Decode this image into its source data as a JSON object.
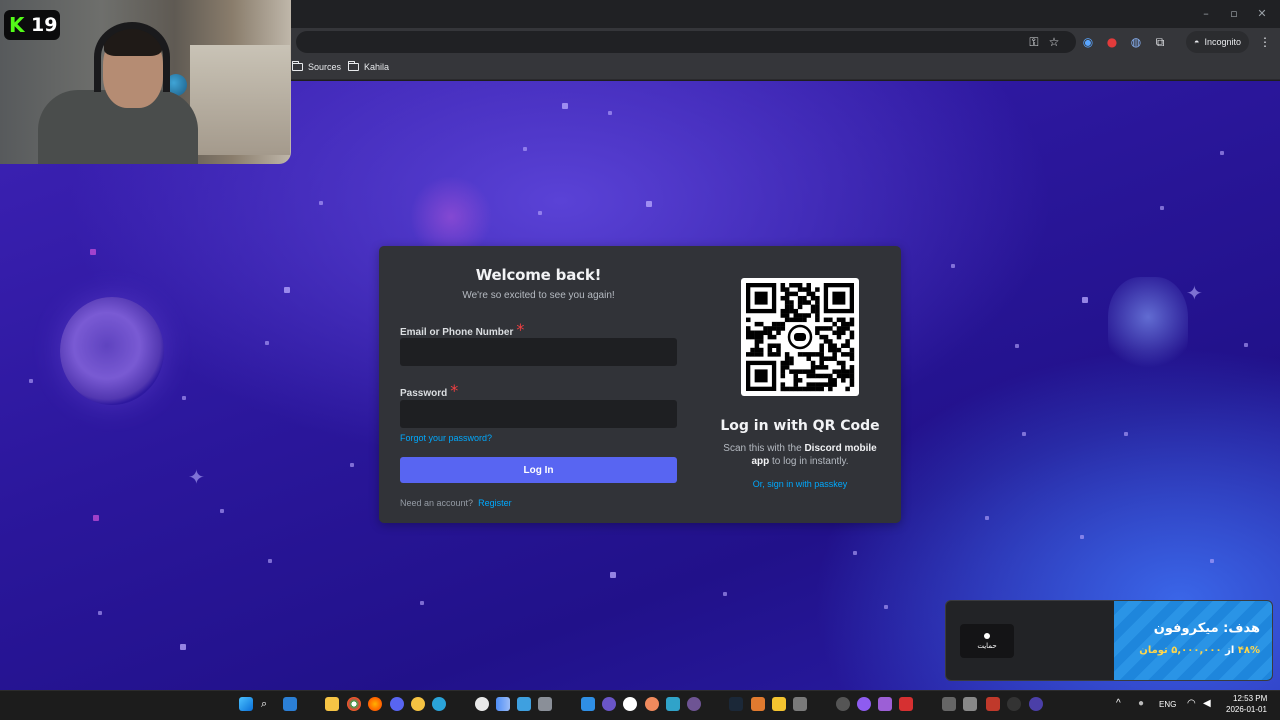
{
  "browser": {
    "bookmarks": [
      "Sources",
      "Kahila"
    ],
    "incognito_label": "Incognito",
    "colors": {
      "frame": "#202124",
      "toolbar": "#35363a"
    }
  },
  "login": {
    "title": "Welcome back!",
    "subtitle": "We're so excited to see you again!",
    "email_label": "Email or Phone Number",
    "email_value": "",
    "password_label": "Password",
    "password_value": "",
    "required_mark": "*",
    "forgot_link": "Forgot your password?",
    "login_button": "Log In",
    "need_account": "Need an account?",
    "register_link": "Register",
    "colors": {
      "card": "#313338",
      "input": "#1e1f22",
      "button": "#5865f2",
      "link": "#00a8fc",
      "required": "#f23f42"
    }
  },
  "qr": {
    "title": "Log in with QR Code",
    "desc_prefix": "Scan this with the",
    "desc_bold": "Discord mobile app",
    "desc_suffix": "to log in instantly.",
    "passkey_link": "Or, sign in with passkey"
  },
  "stream": {
    "viewer_count": "19"
  },
  "donation": {
    "goal_title": "هدف: میکروفون",
    "goal_percent": "۴۸%",
    "goal_connector": "از",
    "goal_amount": "۵,۰۰۰,۰۰۰ تومان",
    "support_label": "حمایت"
  },
  "taskbar": {
    "language": "ENG",
    "time": "12:53 PM",
    "date": "2026-01-01"
  }
}
